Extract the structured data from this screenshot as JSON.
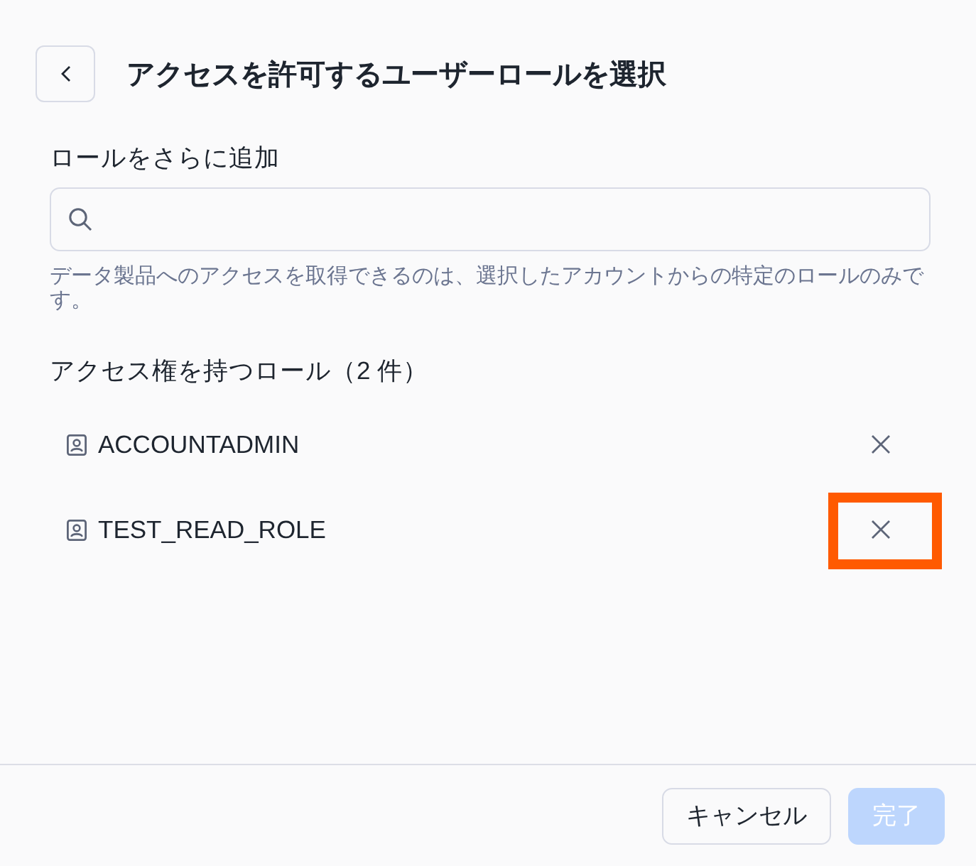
{
  "title": "アクセスを許可するユーザーロールを選択",
  "search": {
    "label": "ロールをさらに追加",
    "helper_text": "データ製品へのアクセスを取得できるのは、選択したアカウントからの特定のロールのみです。"
  },
  "roles_section": {
    "heading": "アクセス権を持つロール（2 件）",
    "roles": [
      {
        "name": "ACCOUNTADMIN",
        "highlighted": false
      },
      {
        "name": "TEST_READ_ROLE",
        "highlighted": true
      }
    ]
  },
  "footer": {
    "buttons": [
      {
        "label": "キャンセル",
        "kind": "secondary",
        "disabled": false
      },
      {
        "label": "完了",
        "kind": "primary",
        "disabled": true
      }
    ]
  }
}
